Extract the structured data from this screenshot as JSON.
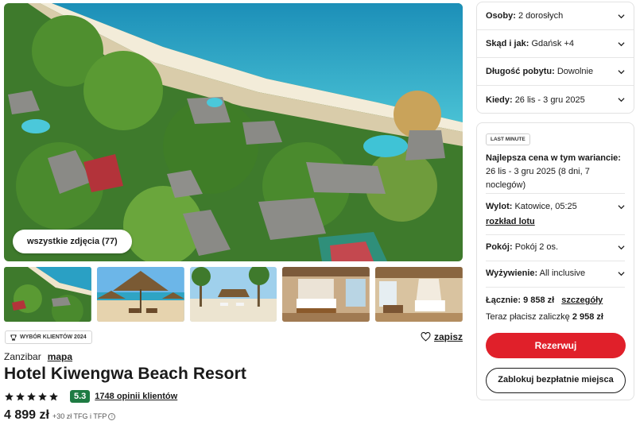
{
  "gallery": {
    "all_photos_label": "wszystkie zdjęcia (77)",
    "thumbnails": [
      "aerial-resort",
      "beach-umbrellas",
      "beach-palms",
      "hotel-room",
      "hotel-suite"
    ]
  },
  "hotel": {
    "award_label": "WYBÓR KLIENTÓW 2024",
    "save_label": "zapisz",
    "location": "Zanzibar",
    "map_label": "mapa",
    "name": "Hotel Kiwengwa Beach Resort",
    "stars": 5,
    "score": "5.3",
    "reviews_label": "1748 opinii klientów",
    "price": "4 899 zł",
    "price_extra": "+30 zł TFG i TFP"
  },
  "search": {
    "rows": [
      {
        "label": "Osoby:",
        "value": "2 dorosłych"
      },
      {
        "label": "Skąd i jak:",
        "value": "Gdańsk +4"
      },
      {
        "label": "Długość pobytu:",
        "value": "Dowolnie"
      },
      {
        "label": "Kiedy:",
        "value": "26 lis - 3 gru 2025"
      }
    ]
  },
  "offer": {
    "badge": "LAST MINUTE",
    "best_label": "Najlepsza cena w tym wariancie:",
    "best_value": "26 lis - 3 gru 2025 (8 dni, 7 noclegów)",
    "flight_label": "Wylot:",
    "flight_value": "Katowice, 05:25",
    "flight_link": "rozkład lotu",
    "room_label": "Pokój:",
    "room_value": "Pokój 2 os.",
    "board_label": "Wyżywienie:",
    "board_value": "All inclusive",
    "total_label": "Łącznie: 9 858 zł",
    "details_label": "szczegóły",
    "deposit_text": "Teraz płacisz zaliczkę",
    "deposit_value": "2 958 zł",
    "reserve_label": "Rezerwuj",
    "block_label": "Zablokuj bezpłatnie miejsca"
  },
  "colors": {
    "accent_red": "#e0202a",
    "score_green": "#1e7b43",
    "sea": "#2aa7c9"
  }
}
